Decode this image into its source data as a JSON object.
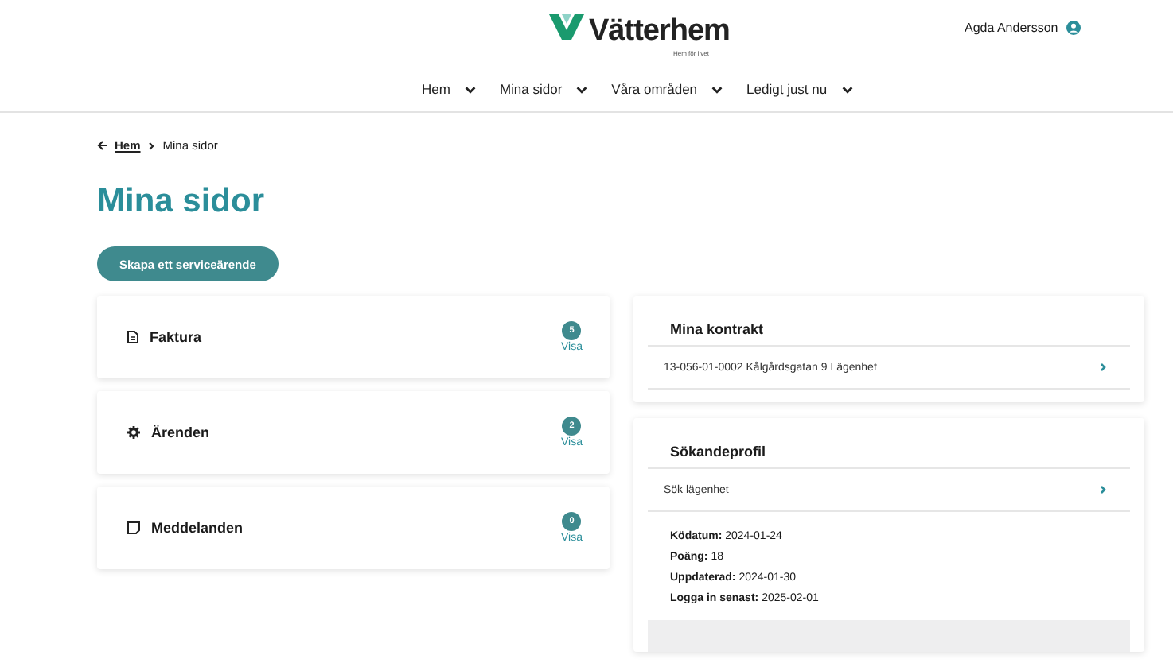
{
  "header": {
    "logo": {
      "name": "Vätterhem",
      "tagline": "Hem för livet"
    },
    "user": "Agda Andersson"
  },
  "nav": [
    {
      "label": "Hem"
    },
    {
      "label": "Mina sidor"
    },
    {
      "label": "Våra områden"
    },
    {
      "label": "Ledigt just nu"
    }
  ],
  "breadcrumb": {
    "back": "Hem",
    "current": "Mina sidor"
  },
  "page_title": "Mina sidor",
  "action_button": "Skapa ett serviceärende",
  "summary_cards": [
    {
      "kind": "invoice",
      "title": "Faktura",
      "count": "5",
      "link": "Visa"
    },
    {
      "kind": "gear",
      "title": "Ärenden",
      "count": "2",
      "link": "Visa"
    },
    {
      "kind": "message",
      "title": "Meddelanden",
      "count": "0",
      "link": "Visa"
    }
  ],
  "contracts": {
    "title": "Mina kontrakt",
    "items": [
      "13-056-01-0002 Kålgårdsgatan 9 Lägenhet"
    ]
  },
  "profile": {
    "title": "Sökandeprofil",
    "link": "Sök lägenhet",
    "details": [
      {
        "label": "Ködatum:",
        "value": "2024-01-24"
      },
      {
        "label": "Poäng:",
        "value": "18"
      },
      {
        "label": "Uppdaterad:",
        "value": "2024-01-30"
      },
      {
        "label": "Logga in senast:",
        "value": "2025-02-01"
      }
    ]
  }
}
